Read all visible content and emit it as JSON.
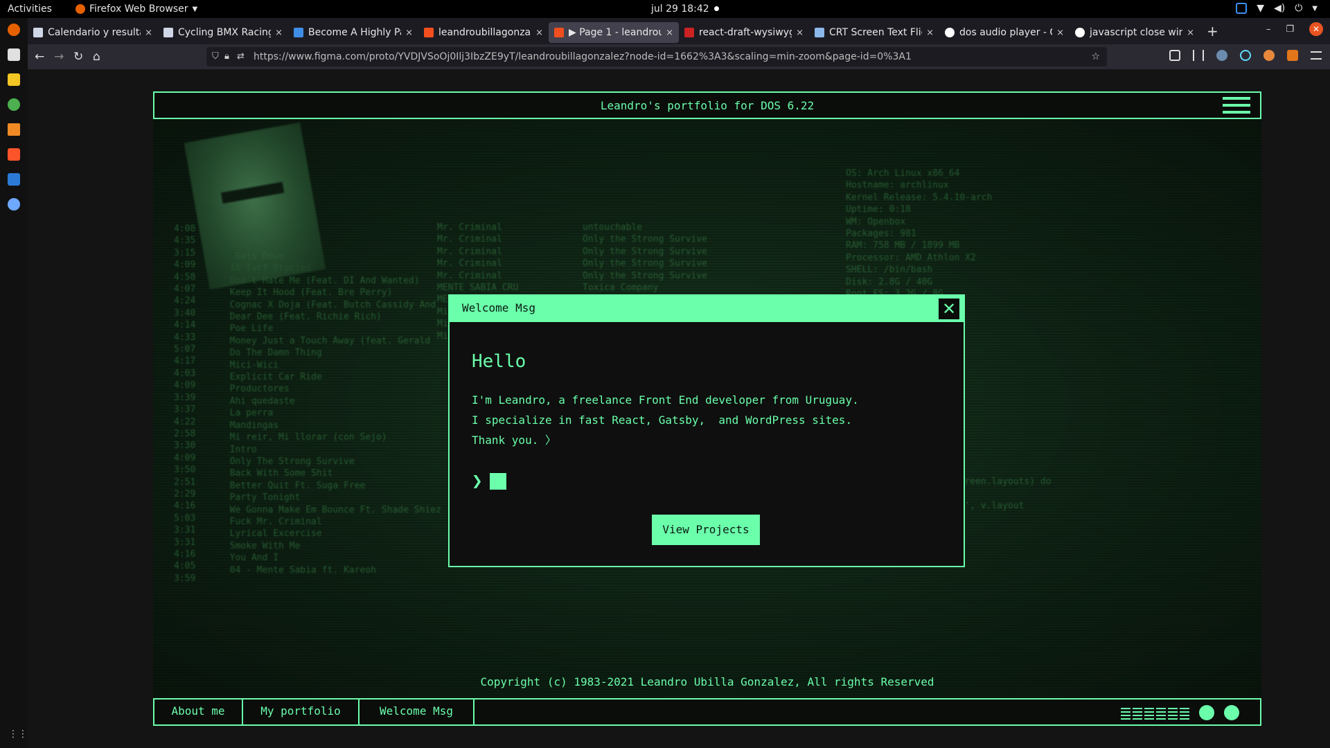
{
  "topbar": {
    "activities": "Activities",
    "app_name": "Firefox Web Browser",
    "clock": "jul 29  18:42"
  },
  "tabs": [
    {
      "label": "Calendario y resulta",
      "color": "#cfd7e6"
    },
    {
      "label": "Cycling BMX Racing",
      "color": "#cfd7e6"
    },
    {
      "label": "Become A Highly Pa",
      "color": "#3e8ee8"
    },
    {
      "label": "leandroubillagonza",
      "color": "#f24e1e"
    },
    {
      "label": "▶ Page 1 - leandrou",
      "color": "#f24e1e"
    },
    {
      "label": "react-draft-wysiwyg",
      "color": "#cc2222"
    },
    {
      "label": "CRT Screen Text Flic",
      "color": "#8bb8e8"
    },
    {
      "label": "dos audio player - G",
      "color": "#ffffff"
    },
    {
      "label": "javascript close win",
      "color": "#ffffff"
    }
  ],
  "nav": {
    "url": "https://www.figma.com/proto/YVDJVSoOj0Ilj3IbzZE9yT/leandroubillagonzalez?node-id=1662%3A3&scaling=min-zoom&page-id=0%3A1"
  },
  "portfolio": {
    "header_title": "Leandro's portfolio for DOS 6.22",
    "copyright": "Copyright (c) 1983-2021 Leandro Ubilla Gonzalez, All rights Reserved",
    "taskbar": [
      "About me",
      "My portfolio",
      "Welcome Msg"
    ]
  },
  "modal": {
    "title": "Welcome Msg",
    "heading": "Hello",
    "lines": [
      "I'm Leandro, a freelance Front End developer from Uruguay.",
      "I specialize in fast React, Gatsby,  and WordPress sites.",
      "Thank you. 〉"
    ],
    "button": "View Projects"
  },
  "colors": {
    "accent": "#6bffab"
  }
}
